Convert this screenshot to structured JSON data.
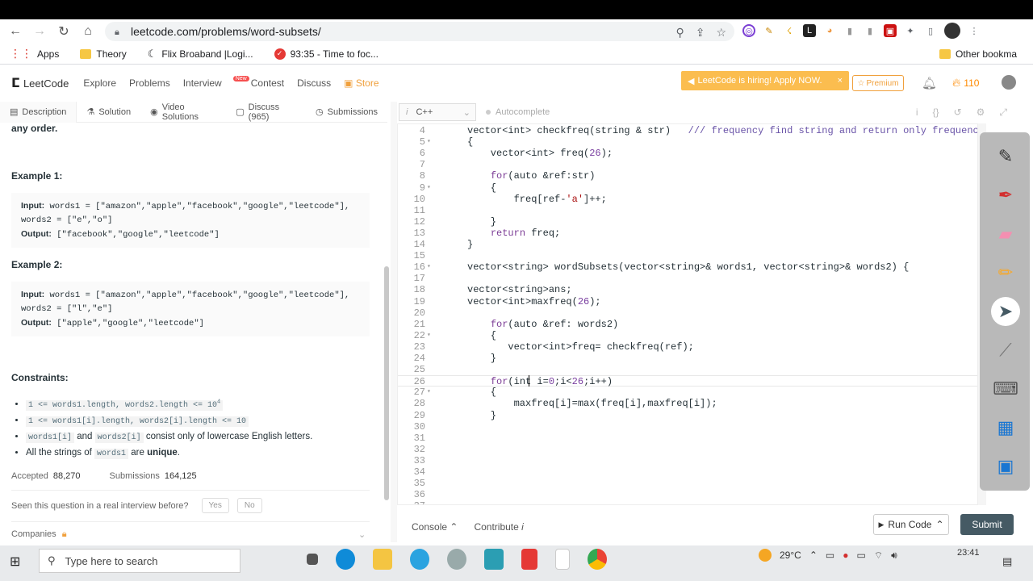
{
  "browser": {
    "url": "leetcode.com/problems/word-subsets/",
    "bookmarks": [
      "Apps",
      "Theory",
      "Flix Broaband |Logi...",
      "93:35 - Time to foc..."
    ],
    "other_bookmarks": "Other bookma"
  },
  "header": {
    "logo": "LeetCode",
    "nav": [
      "Explore",
      "Problems",
      "Interview",
      "Contest",
      "Discuss",
      "Store"
    ],
    "new_badge": "New",
    "hiring": "LeetCode is hiring! Apply NOW.",
    "premium": "Premium",
    "streak": "110"
  },
  "tabs": [
    "Description",
    "Solution",
    "Video Solutions",
    "Discuss (965)",
    "Submissions"
  ],
  "left": {
    "any_order": "any order.",
    "example1_title": "Example 1:",
    "example1_input": "Input:",
    "example1_input_value": " words1 = [\"amazon\",\"apple\",\"facebook\",\"google\",\"leetcode\"],",
    "example1_input_value2": "words2 = [\"e\",\"o\"]",
    "example1_output": "Output:",
    "example1_output_value": " [\"facebook\",\"google\",\"leetcode\"]",
    "example2_title": "Example 2:",
    "example2_input": "Input:",
    "example2_input_value": " words1 = [\"amazon\",\"apple\",\"facebook\",\"google\",\"leetcode\"],",
    "example2_input_value2": "words2 = [\"l\",\"e\"]",
    "example2_output": "Output:",
    "example2_output_value": " [\"apple\",\"google\",\"leetcode\"]",
    "constraints_title": "Constraints:",
    "c1": "1 <= words1.length, words2.length <= 10",
    "c1_sup": "4",
    "c2": "1 <= words1[i].length, words2[i].length <= 10",
    "c3a": "words1[i]",
    "c3b": "and",
    "c3c": "words2[i]",
    "c3d": "consist only of lowercase English letters.",
    "c4a": "All the strings of",
    "c4b": "words1",
    "c4c": "are",
    "c4d": "unique",
    "c4e": ".",
    "accepted_label": "Accepted",
    "accepted_value": "88,270",
    "submissions_label": "Submissions",
    "submissions_value": "164,125",
    "seen": "Seen this question in a real interview before?",
    "yes": "Yes",
    "no": "No",
    "companies": "Companies"
  },
  "editor": {
    "language": "C++",
    "autocomplete": "Autocomplete",
    "lines": [
      {
        "n": "4",
        "fold": "",
        "t": "vector<int> checkfreq(string & str)   /// frequency find string and return only frequency"
      },
      {
        "n": "5",
        "fold": "▾",
        "t": "{"
      },
      {
        "n": "6",
        "fold": "",
        "t": "    vector<int> freq(26);"
      },
      {
        "n": "7",
        "fold": "",
        "t": ""
      },
      {
        "n": "8",
        "fold": "",
        "t": "    for(auto &ref:str)"
      },
      {
        "n": "9",
        "fold": "▾",
        "t": "    {"
      },
      {
        "n": "10",
        "fold": "",
        "t": "        freq[ref-'a']++;"
      },
      {
        "n": "11",
        "fold": "",
        "t": ""
      },
      {
        "n": "12",
        "fold": "",
        "t": "    }"
      },
      {
        "n": "13",
        "fold": "",
        "t": "    return freq;"
      },
      {
        "n": "14",
        "fold": "",
        "t": "}"
      },
      {
        "n": "15",
        "fold": "",
        "t": ""
      },
      {
        "n": "16",
        "fold": "▾",
        "t": "vector<string> wordSubsets(vector<string>& words1, vector<string>& words2) {"
      },
      {
        "n": "17",
        "fold": "",
        "t": ""
      },
      {
        "n": "18",
        "fold": "",
        "t": "vector<string>ans;"
      },
      {
        "n": "19",
        "fold": "",
        "t": "vector<int>maxfreq(26);"
      },
      {
        "n": "20",
        "fold": "",
        "t": ""
      },
      {
        "n": "21",
        "fold": "",
        "t": "    for(auto &ref: words2)"
      },
      {
        "n": "22",
        "fold": "▾",
        "t": "    {"
      },
      {
        "n": "23",
        "fold": "",
        "t": "       vector<int>freq= checkfreq(ref);"
      },
      {
        "n": "24",
        "fold": "",
        "t": "    }"
      },
      {
        "n": "25",
        "fold": "",
        "t": ""
      },
      {
        "n": "26",
        "fold": "",
        "t": "    for(int i=0;i<26;i++)"
      },
      {
        "n": "27",
        "fold": "▾",
        "t": "    {"
      },
      {
        "n": "28",
        "fold": "",
        "t": "        maxfreq[i]=max(freq[i],maxfreq[i]);"
      },
      {
        "n": "29",
        "fold": "",
        "t": "    }"
      },
      {
        "n": "30",
        "fold": "",
        "t": ""
      },
      {
        "n": "31",
        "fold": "",
        "t": ""
      },
      {
        "n": "32",
        "fold": "",
        "t": ""
      },
      {
        "n": "33",
        "fold": "",
        "t": ""
      },
      {
        "n": "34",
        "fold": "",
        "t": ""
      },
      {
        "n": "35",
        "fold": "",
        "t": ""
      },
      {
        "n": "36",
        "fold": "",
        "t": ""
      },
      {
        "n": "37",
        "fold": "",
        "t": ""
      }
    ]
  },
  "bottom": {
    "console": "Console",
    "contribute": "Contribute",
    "run": "Run Code",
    "submit": "Submit"
  },
  "taskbar": {
    "search": "Type here to search",
    "weather": "29°C",
    "time": "23:41"
  },
  "colors": {
    "leetcode_orange": "#f0a03c",
    "submit_bg": "#455a64",
    "hiring_bg": "#fbbd4f"
  }
}
